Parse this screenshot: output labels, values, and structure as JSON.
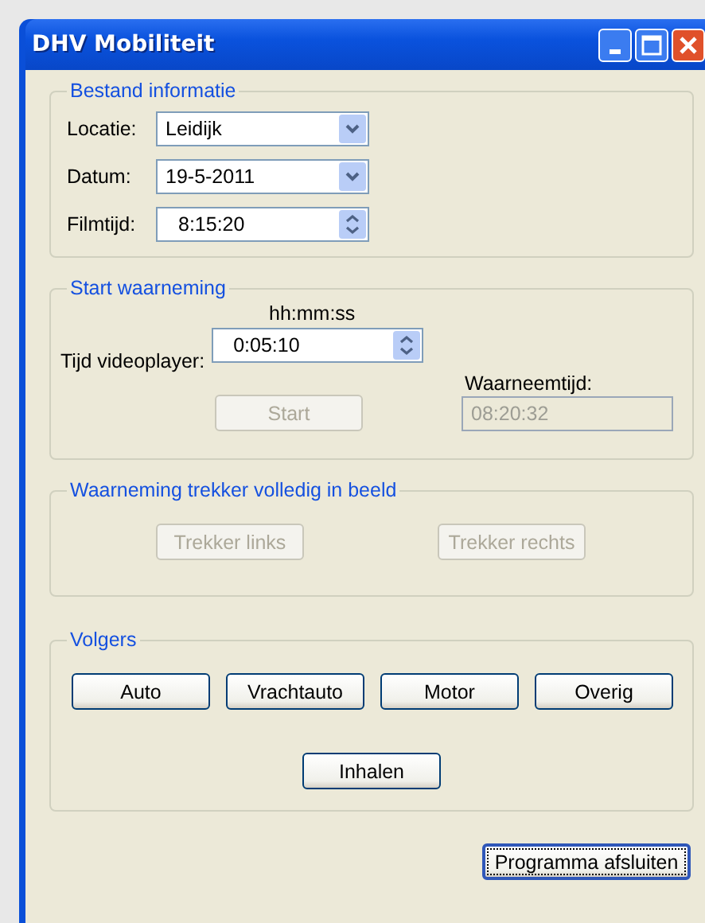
{
  "window": {
    "title": "DHV Mobiliteit"
  },
  "bestand_informatie": {
    "title": "Bestand informatie",
    "fields": [
      {
        "label": "Locatie:",
        "value": "Leidijk",
        "kind": "combo"
      },
      {
        "label": "Datum:",
        "value": "19-5-2011",
        "kind": "combo"
      },
      {
        "label": "Filmtijd:",
        "value": "8:15:20",
        "kind": "spin"
      }
    ]
  },
  "start_waarneming": {
    "title": "Start waarneming",
    "format_hint": "hh:mm:ss",
    "label": "Tijd videoplayer:",
    "value": "0:05:10",
    "start_button": {
      "label": "Start",
      "disabled": true
    },
    "waarneemtijd_label": "Waarneemtijd:",
    "waarneemtijd_value": "08:20:32",
    "waarneemtijd_disabled": true
  },
  "trekker": {
    "title": "Waarneming trekker volledig in beeld",
    "buttons": [
      {
        "label": "Trekker links",
        "disabled": true
      },
      {
        "label": "Trekker rechts",
        "disabled": true
      }
    ]
  },
  "volgers": {
    "title": "Volgers",
    "buttons": [
      {
        "label": "Auto",
        "disabled": false
      },
      {
        "label": "Vrachtauto",
        "disabled": false
      },
      {
        "label": "Motor",
        "disabled": false
      },
      {
        "label": "Overig",
        "disabled": false
      }
    ],
    "inhalen": {
      "label": "Inhalen",
      "disabled": false
    }
  },
  "close_button": {
    "label": "Programma afsluiten"
  }
}
